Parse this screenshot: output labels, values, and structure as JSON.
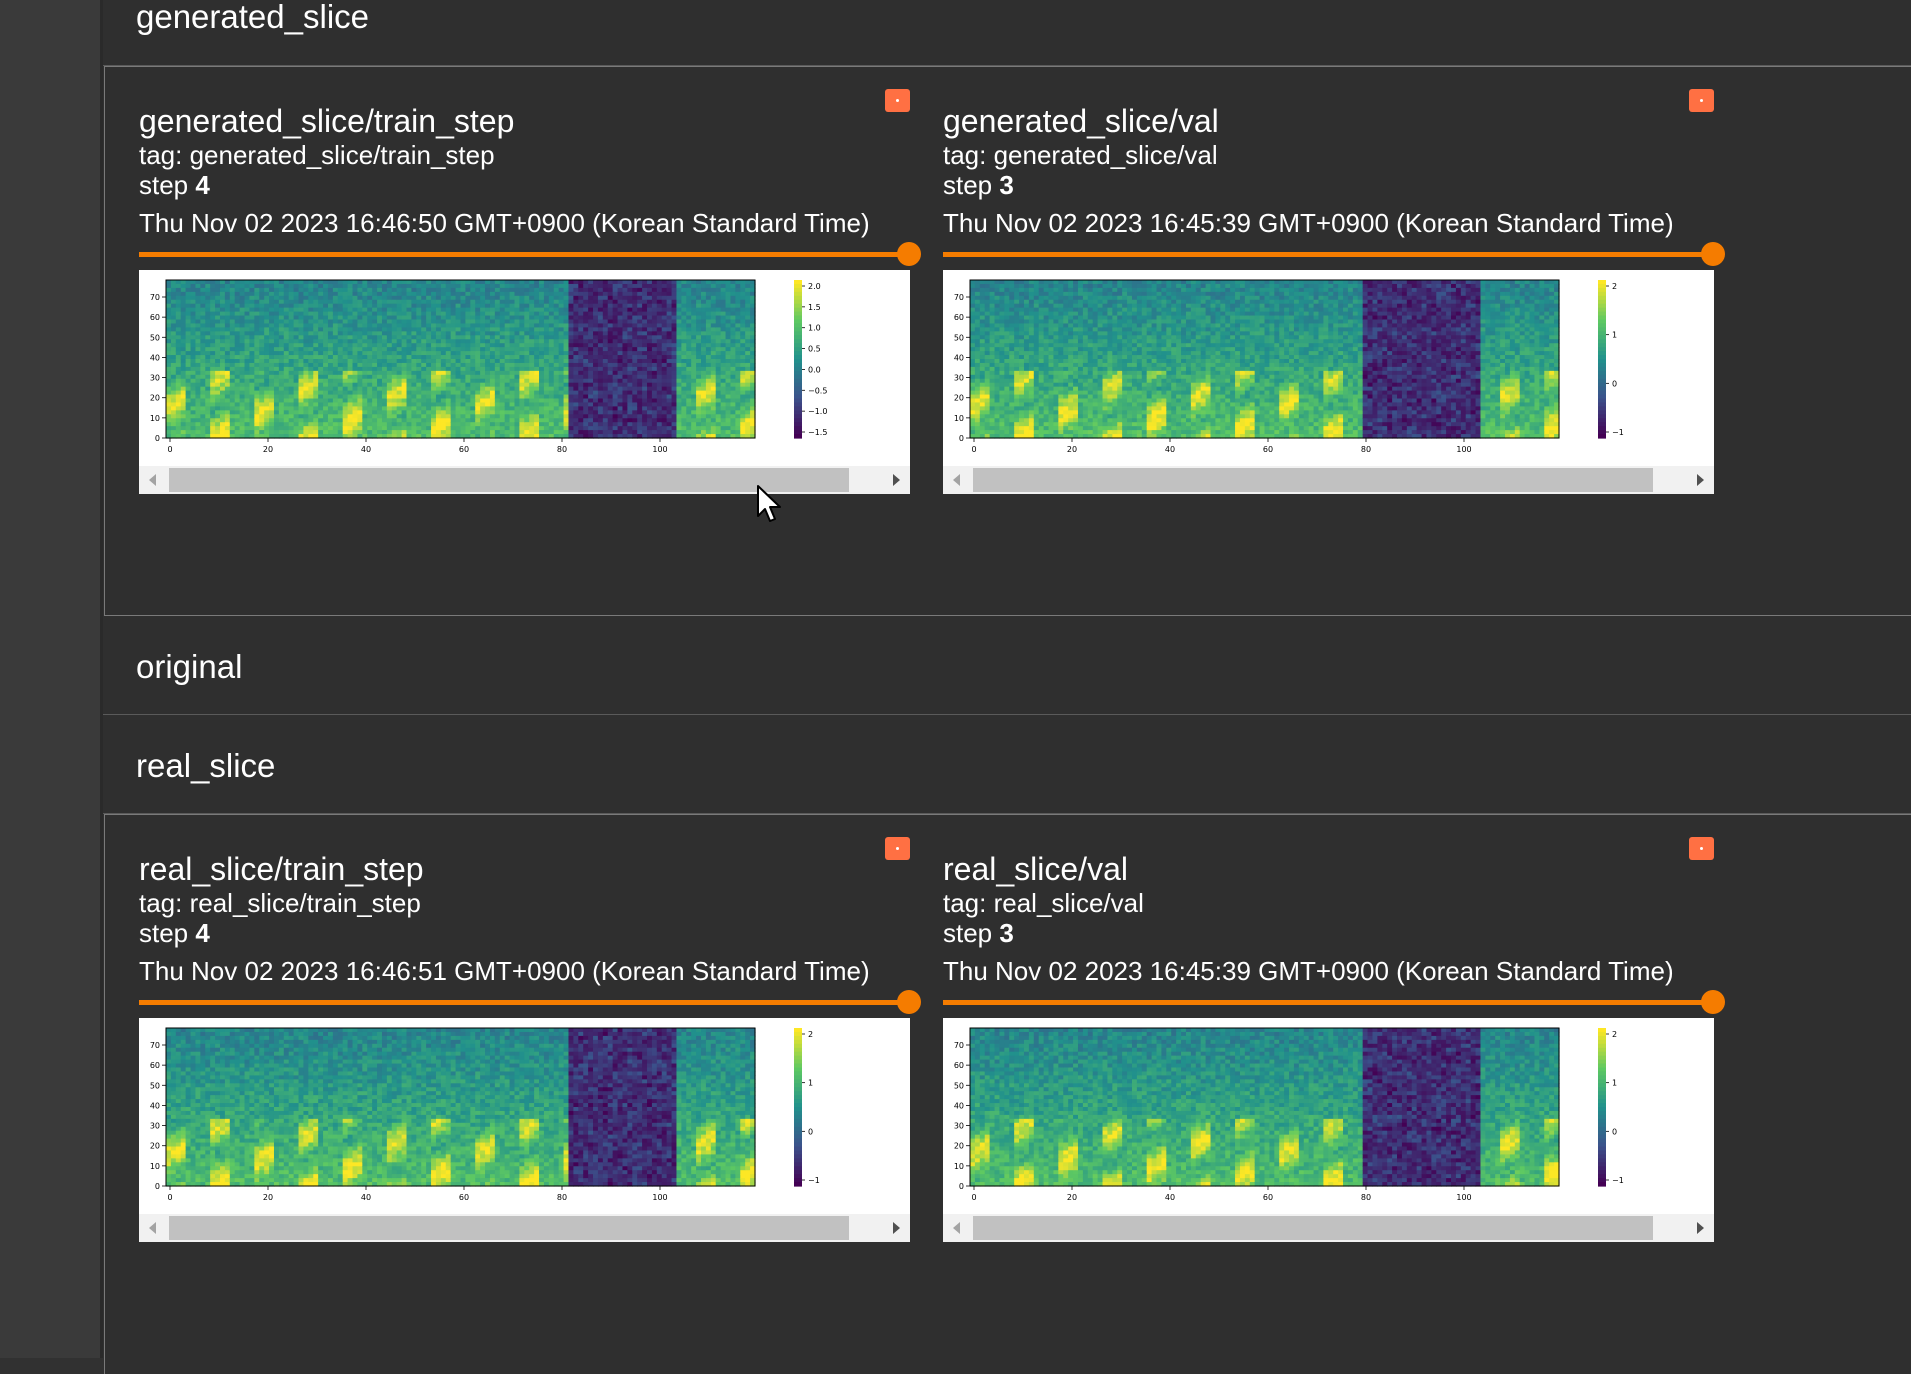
{
  "groups": {
    "generated_slice": {
      "title": "generated_slice"
    },
    "original": {
      "title": "original"
    },
    "real_slice": {
      "title": "real_slice"
    }
  },
  "cards": [
    {
      "title": "generated_slice/train_step",
      "tag": "tag: generated_slice/train_step",
      "step_label": "step",
      "step_value": "4",
      "timestamp": "Thu Nov 02 2023 16:46:50 GMT+0900 (Korean Standard Time)",
      "cbar_ticks": [
        "2.0",
        "1.5",
        "1.0",
        "0.5",
        "0.0",
        "−0.5",
        "−1.0",
        "−1.5"
      ]
    },
    {
      "title": "generated_slice/val",
      "tag": "tag: generated_slice/val",
      "step_label": "step",
      "step_value": "3",
      "timestamp": "Thu Nov 02 2023 16:45:39 GMT+0900 (Korean Standard Time)",
      "cbar_ticks": [
        "2",
        "1",
        "0",
        "−1"
      ]
    },
    {
      "title": "real_slice/train_step",
      "tag": "tag: real_slice/train_step",
      "step_label": "step",
      "step_value": "4",
      "timestamp": "Thu Nov 02 2023 16:46:51 GMT+0900 (Korean Standard Time)",
      "cbar_ticks": [
        "2",
        "1",
        "0",
        "−1"
      ]
    },
    {
      "title": "real_slice/val",
      "tag": "tag: real_slice/val",
      "step_label": "step",
      "step_value": "3",
      "timestamp": "Thu Nov 02 2023 16:45:39 GMT+0900 (Korean Standard Time)",
      "cbar_ticks": [
        "2",
        "1",
        "0",
        "−1"
      ]
    }
  ],
  "plot_axes": {
    "y_ticks": [
      "70",
      "60",
      "50",
      "40",
      "30",
      "20",
      "10",
      "0"
    ],
    "x_ticks": [
      "0",
      "20",
      "40",
      "60",
      "80",
      "100"
    ]
  },
  "icons": {
    "card_menu": "more-vert-icon",
    "scroll_left": "arrow-left-icon",
    "scroll_right": "arrow-right-icon",
    "cursor": "mouse-pointer-icon"
  },
  "colors": {
    "background": "#313131",
    "accent_orange": "#f57c00",
    "menu_button": "#ff7043",
    "viridis_low": "#440154",
    "viridis_mid": "#21918c",
    "viridis_high": "#fde725"
  }
}
